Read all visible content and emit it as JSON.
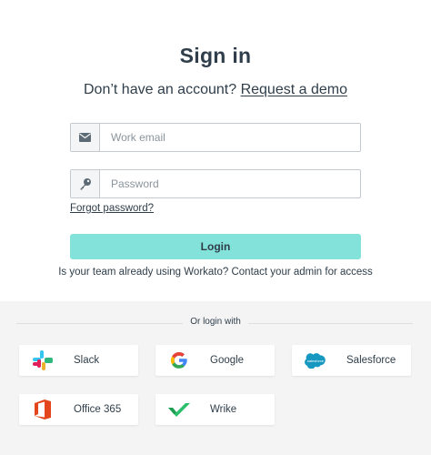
{
  "heading": "Sign in",
  "subtitle": {
    "prefix": "Don’t have an account?",
    "link": "Request a demo"
  },
  "email": {
    "placeholder": "Work email",
    "value": ""
  },
  "password": {
    "placeholder": "Password",
    "value": ""
  },
  "forgot_label": "Forgot password?",
  "login_label": "Login",
  "admin_note": "Is your team already using Workato? Contact your admin for access",
  "or_login_with": "Or login with",
  "providers": [
    {
      "label": "Slack",
      "icon": "slack-icon"
    },
    {
      "label": "Google",
      "icon": "google-icon"
    },
    {
      "label": "Salesforce",
      "icon": "salesforce-icon",
      "logo_text": "salesforce"
    },
    {
      "label": "Office 365",
      "icon": "office365-icon"
    },
    {
      "label": "Wrike",
      "icon": "wrike-icon"
    }
  ],
  "colors": {
    "accent": "#83e2d9",
    "text": "#2f3e4a",
    "panel": "#f4f4f5"
  }
}
